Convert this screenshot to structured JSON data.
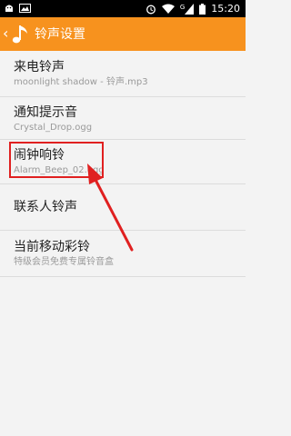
{
  "status_bar": {
    "time": "15:20",
    "network": "G",
    "icons": [
      "android-debug-icon",
      "image-icon",
      "alarm-icon",
      "wifi-icon",
      "signal-icon",
      "battery-icon"
    ]
  },
  "header": {
    "title": "铃声设置",
    "back_icon": "chevron-left-icon",
    "app_icon": "music-note-icon",
    "background": "#f7921e"
  },
  "settings": [
    {
      "title": "来电铃声",
      "subtitle": "moonlight shadow - 铃声.mp3"
    },
    {
      "title": "通知提示音",
      "subtitle": "Crystal_Drop.ogg"
    },
    {
      "title": "闹钟响铃",
      "subtitle": "Alarm_Beep_02.ogg"
    },
    {
      "title": "联系人铃声",
      "subtitle": ""
    },
    {
      "title": "当前移动彩铃",
      "subtitle": "特级会员免费专属铃音盒"
    }
  ],
  "annotation": {
    "color": "#e02020"
  }
}
